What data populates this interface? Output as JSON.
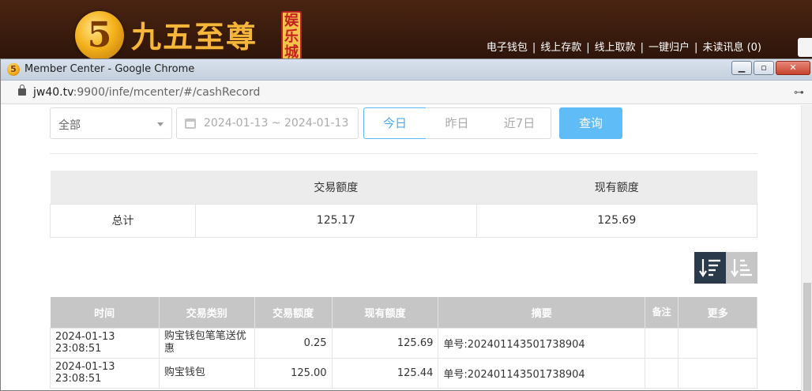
{
  "site": {
    "logo_char": "5",
    "brand_name": "九五至尊",
    "brand_badge": "娱乐城",
    "top_links": [
      "电子钱包",
      "线上存款",
      "线上取款",
      "一键归户",
      "未读讯息 (0)"
    ],
    "link_separator": "|"
  },
  "window": {
    "title": "Member Center - Google Chrome",
    "url_host": "jw40.tv",
    "url_rest": ":9900/infe/mcenter/#/cashRecord",
    "buttons": {
      "minimize": "▁",
      "maximize": "▫",
      "close": "✕"
    }
  },
  "filters": {
    "type_select": "全部",
    "date_range": "2024-01-13 ~ 2024-01-13",
    "today": "今日",
    "yesterday": "昨日",
    "last7": "近7日",
    "query": "查询"
  },
  "summary": {
    "headers": [
      "",
      "交易额度",
      "现有额度"
    ],
    "row_label": "总计",
    "trade_amount": "125.17",
    "balance": "125.69"
  },
  "records": {
    "headers": [
      "时间",
      "交易类别",
      "交易额度",
      "现有额度",
      "摘要",
      "备注",
      "更多"
    ],
    "rows": [
      {
        "time": "2024-01-13 23:08:51",
        "type": "购宝钱包笔笔送优惠",
        "amount": "0.25",
        "balance": "125.69",
        "memo": "单号:202401143501738904",
        "note": "",
        "more": ""
      },
      {
        "time": "2024-01-13 23:08:51",
        "type": "购宝钱包",
        "amount": "125.00",
        "balance": "125.44",
        "memo": "单号:202401143501738904",
        "note": "",
        "more": ""
      }
    ]
  },
  "colors": {
    "accent": "#5fbcf6",
    "header_gray": "#c6c6c6",
    "sort_active": "#2b3a4a"
  }
}
